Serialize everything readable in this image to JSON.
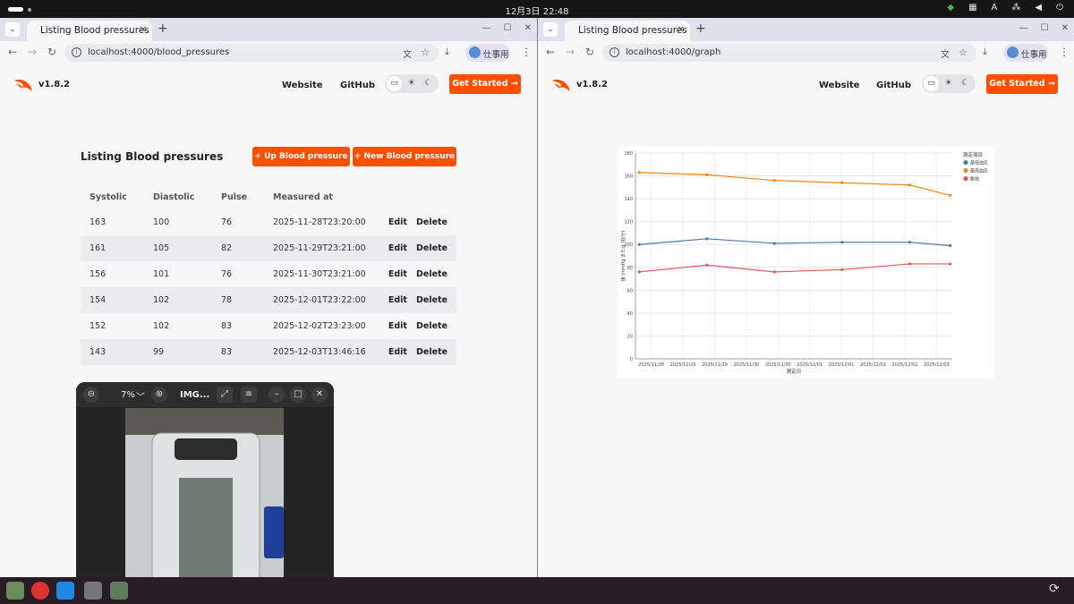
{
  "system": {
    "clock": "12月3日 22:48",
    "tray": [
      "A"
    ]
  },
  "left": {
    "tab_title": "Listing Blood pressures",
    "url": "localhost:4000/blood_pressures",
    "profile": "仕事用",
    "app": {
      "version": "v1.8.2",
      "website": "Website",
      "github": "GitHub",
      "get_started": "Get Started →"
    },
    "page": {
      "title": "Listing Blood pressures",
      "up_button": "+  Up Blood pressure",
      "new_button": "+  New Blood pressure",
      "columns": [
        "Systolic",
        "Diastolic",
        "Pulse",
        "Measured at"
      ],
      "rows": [
        [
          "163",
          "100",
          "76",
          "2025-11-28T23:20:00"
        ],
        [
          "161",
          "105",
          "82",
          "2025-11-29T23:21:00"
        ],
        [
          "156",
          "101",
          "76",
          "2025-11-30T23:21:00"
        ],
        [
          "154",
          "102",
          "78",
          "2025-12-01T23:22:00"
        ],
        [
          "152",
          "102",
          "83",
          "2025-12-02T23:23:00"
        ],
        [
          "143",
          "99",
          "83",
          "2025-12-03T13:46:16"
        ]
      ],
      "edit": "Edit",
      "delete": "Delete"
    }
  },
  "right": {
    "tab_title": "Listing Blood pressures",
    "url": "localhost:4000/graph",
    "profile": "仕事用",
    "app": {
      "version": "v1.8.2",
      "website": "Website",
      "github": "GitHub",
      "get_started": "Get Started →"
    }
  },
  "viewer": {
    "zoom": "7%",
    "title": "IMG..."
  },
  "chart_data": {
    "type": "line",
    "x": [
      "2025-11-28T23:20",
      "2025-11-29T23:21",
      "2025-11-30T23:21",
      "2025-12-01T23:22",
      "2025-12-02T23:23",
      "2025-12-03T13:46"
    ],
    "tick_labels": [
      "2025/11/28",
      "2025/11/29",
      "2025/11/29",
      "2025/11/30",
      "2025/11/30",
      "2025/12/01",
      "2025/12/01",
      "2025/12/02",
      "2025/12/02",
      "2025/12/03"
    ],
    "series": [
      {
        "name": "最低血圧",
        "color": "#4c78a8",
        "values": [
          100,
          105,
          101,
          102,
          102,
          99
        ]
      },
      {
        "name": "最高血圧",
        "color": "#f58518",
        "values": [
          163,
          161,
          156,
          154,
          152,
          143
        ]
      },
      {
        "name": "脈拍",
        "color": "#e45756",
        "values": [
          76,
          82,
          76,
          78,
          83,
          83
        ]
      }
    ],
    "xlabel": "測定日",
    "ylabel": "値 (mmHg または 拍/分)",
    "ylim": [
      0,
      180
    ],
    "yticks": [
      0,
      20,
      40,
      60,
      80,
      100,
      120,
      140,
      160,
      180
    ],
    "legend_title": "測定項目",
    "legend_position": "top-right",
    "grid": true
  }
}
